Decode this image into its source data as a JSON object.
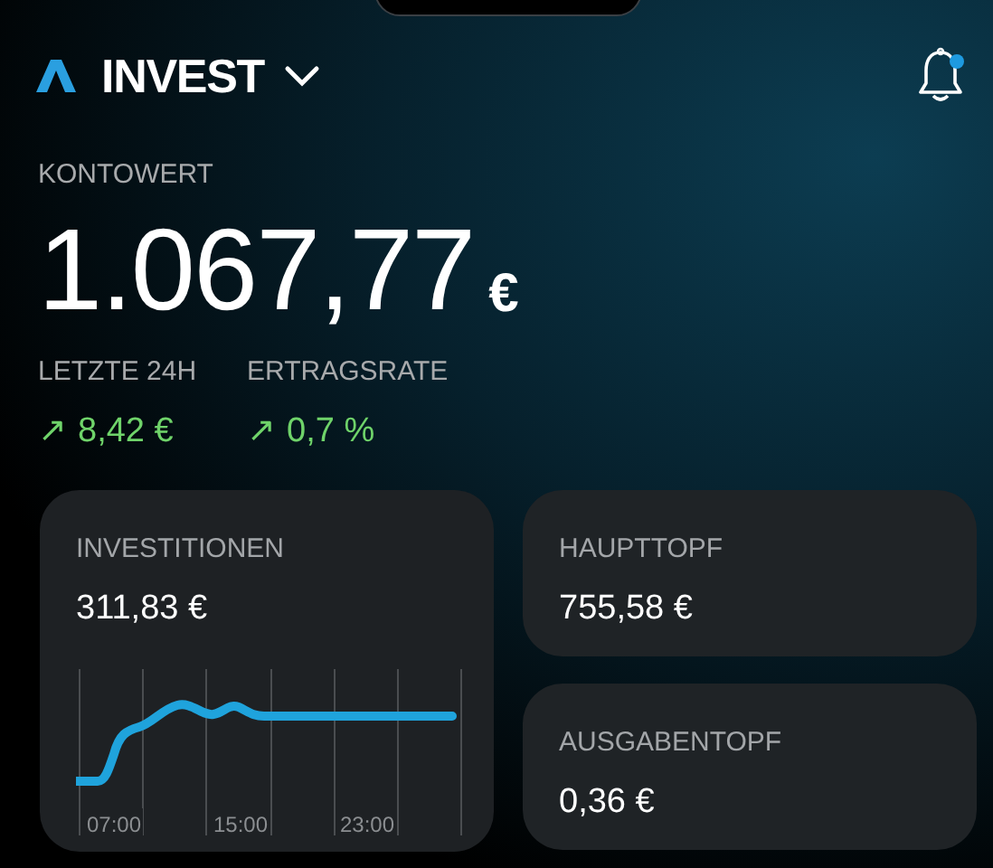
{
  "header": {
    "title": "INVEST",
    "notification_unread": true
  },
  "account": {
    "label": "KONTOWERT",
    "value": "1.067,77",
    "currency": "€"
  },
  "stats": [
    {
      "label": "LETZTE 24H",
      "arrow": "↗",
      "value": "8,42 €"
    },
    {
      "label": "ERTRAGSRATE",
      "arrow": "↗",
      "value": "0,7 %"
    }
  ],
  "cards": [
    {
      "kind": "chart",
      "label": "INVESTITIONEN",
      "value": "311,83 €",
      "axis_labels": [
        "07:00",
        "15:00",
        "23:00"
      ]
    },
    {
      "kind": "plain",
      "label": "HAUPTTOPF",
      "value": "755,58 €"
    },
    {
      "kind": "plain",
      "label": "AUSGABENTOPF",
      "value": "0,36 €"
    }
  ]
}
